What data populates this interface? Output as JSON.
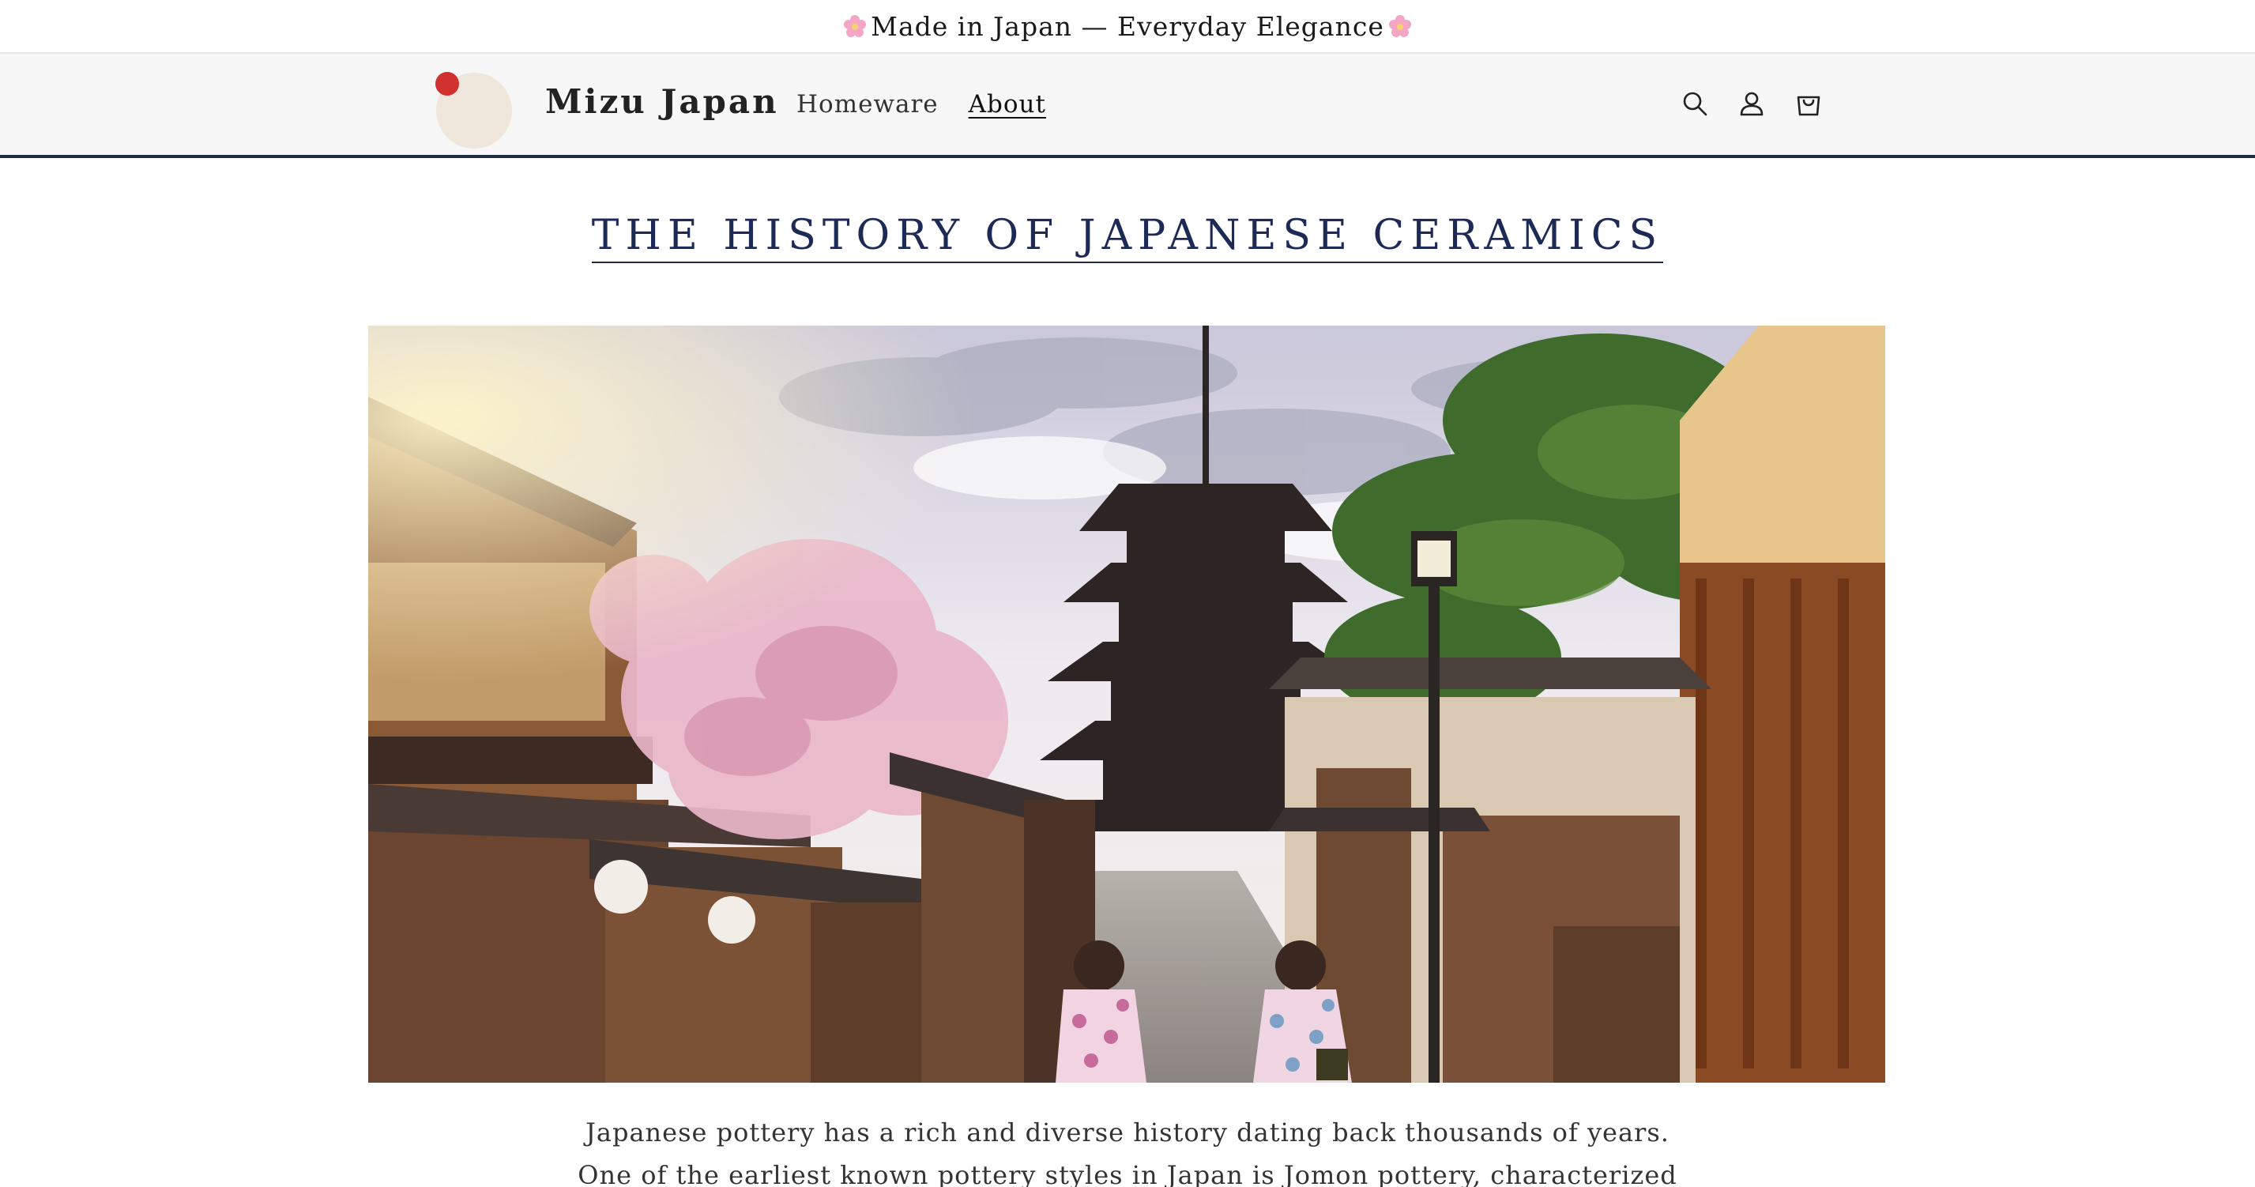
{
  "announcement": {
    "text": "Made in Japan — Everyday Elegance",
    "icon_left": "cherry-blossom-icon",
    "icon_right": "cherry-blossom-icon"
  },
  "header": {
    "brand": "Mizu Japan",
    "logo_icon": "red-sun-circle-logo",
    "nav": [
      {
        "label": "Homeware",
        "active": false
      },
      {
        "label": "About",
        "active": true
      }
    ],
    "icons": [
      "search-icon",
      "account-icon",
      "cart-icon"
    ]
  },
  "main": {
    "title": "THE HISTORY OF JAPANESE CERAMICS",
    "hero_image": "kyoto-street-pagoda-image",
    "paragraph_lines": [
      "Japanese pottery has a rich and diverse history dating back thousands of years.",
      "One of the earliest known pottery styles in Japan is Jomon pottery, characterized"
    ]
  },
  "colors": {
    "accent": "#1d2a55",
    "header_bg": "#f7f7f7",
    "logo_red": "#d0312d"
  }
}
